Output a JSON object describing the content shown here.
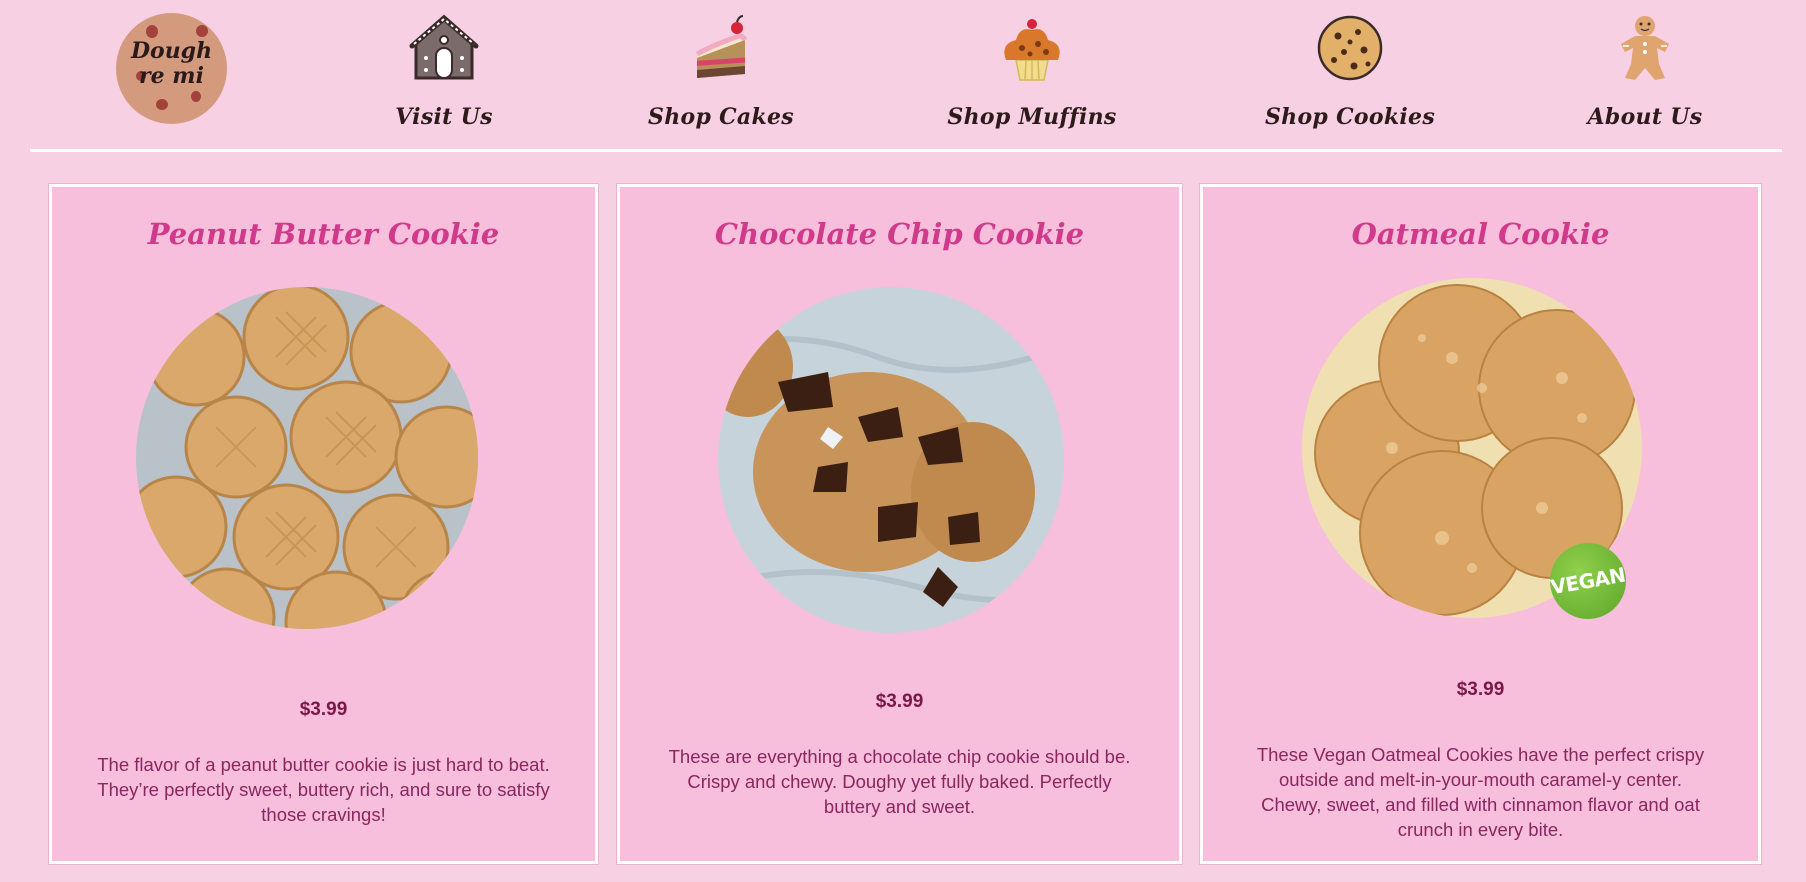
{
  "logo": {
    "text": "Dough\nre mi"
  },
  "nav": {
    "items": [
      {
        "label": "Visit Us",
        "icon": "gingerbread-house-icon"
      },
      {
        "label": "Shop Cakes",
        "icon": "cake-slice-icon"
      },
      {
        "label": "Shop Muffins",
        "icon": "muffin-icon"
      },
      {
        "label": "Shop Cookies",
        "icon": "cookie-icon"
      },
      {
        "label": "About Us",
        "icon": "gingerbread-man-icon"
      }
    ]
  },
  "products": [
    {
      "title": "Peanut Butter Cookie",
      "price": "$3.99",
      "description": "The flavor of a peanut butter cookie is just hard to beat. They’re perfectly sweet, buttery rich, and sure to satisfy those cravings!",
      "image": "peanut-butter-cookies-photo"
    },
    {
      "title": "Chocolate Chip Cookie",
      "price": "$3.99",
      "description": "These are everything a chocolate chip cookie should be. Crispy and chewy. Doughy yet fully baked. Perfectly buttery and sweet.",
      "image": "chocolate-chip-cookie-photo"
    },
    {
      "title": "Oatmeal Cookie",
      "price": "$3.99",
      "description": "These Vegan Oatmeal Cookies have the perfect crispy outside and melt-in-your-mouth caramel-y center. Chewy, sweet, and filled with cinnamon flavor and oat crunch in every bite.",
      "image": "oatmeal-cookies-photo",
      "badge": "VEGAN"
    }
  ],
  "colors": {
    "background": "#f7d0e3",
    "card": "#f7bfdc",
    "title": "#d13a8a",
    "price": "#7a1848",
    "text": "#8a2660"
  }
}
